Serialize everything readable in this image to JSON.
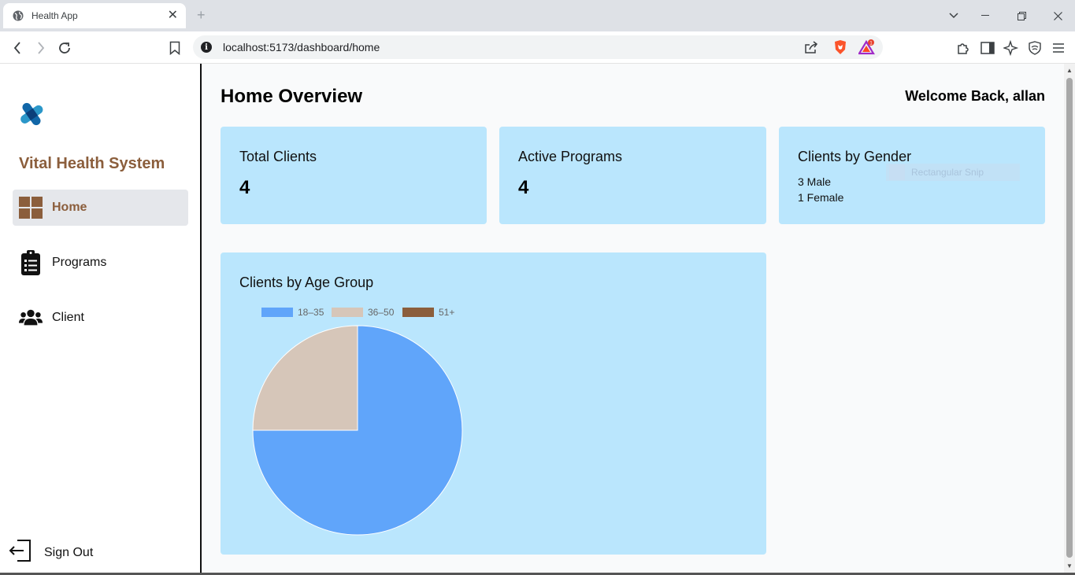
{
  "browser": {
    "tab_title": "Health App",
    "url": "localhost:5173/dashboard/home",
    "brave_badge": "1"
  },
  "sidebar": {
    "brand": "Vital Health System",
    "items": [
      {
        "label": "Home",
        "icon": "grid-icon",
        "active": true
      },
      {
        "label": "Programs",
        "icon": "clipboard-list-icon",
        "active": false
      },
      {
        "label": "Client",
        "icon": "users-icon",
        "active": false
      }
    ],
    "signout_label": "Sign Out"
  },
  "header": {
    "title": "Home Overview",
    "welcome": "Welcome Back, allan"
  },
  "cards": {
    "total_clients": {
      "title": "Total Clients",
      "value": "4"
    },
    "active_programs": {
      "title": "Active Programs",
      "value": "4"
    },
    "gender": {
      "title": "Clients by Gender",
      "male": "3 Male",
      "female": "1 Female"
    }
  },
  "overlay": {
    "text": "Rectangular Snip"
  },
  "age_chart_card": {
    "title": "Clients by Age Group"
  },
  "chart_data": {
    "type": "pie",
    "title": "Clients by Age Group",
    "categories": [
      "18–35",
      "36–50",
      "51+"
    ],
    "values": [
      3,
      1,
      0
    ],
    "colors": [
      "#60a5fa",
      "#d6c6b9",
      "#8b5e3c"
    ],
    "legend": "top-left"
  },
  "colors": {
    "brand": "#8b5e3c",
    "card_bg": "#bae6fd",
    "active_nav_bg": "#e5e7eb"
  }
}
